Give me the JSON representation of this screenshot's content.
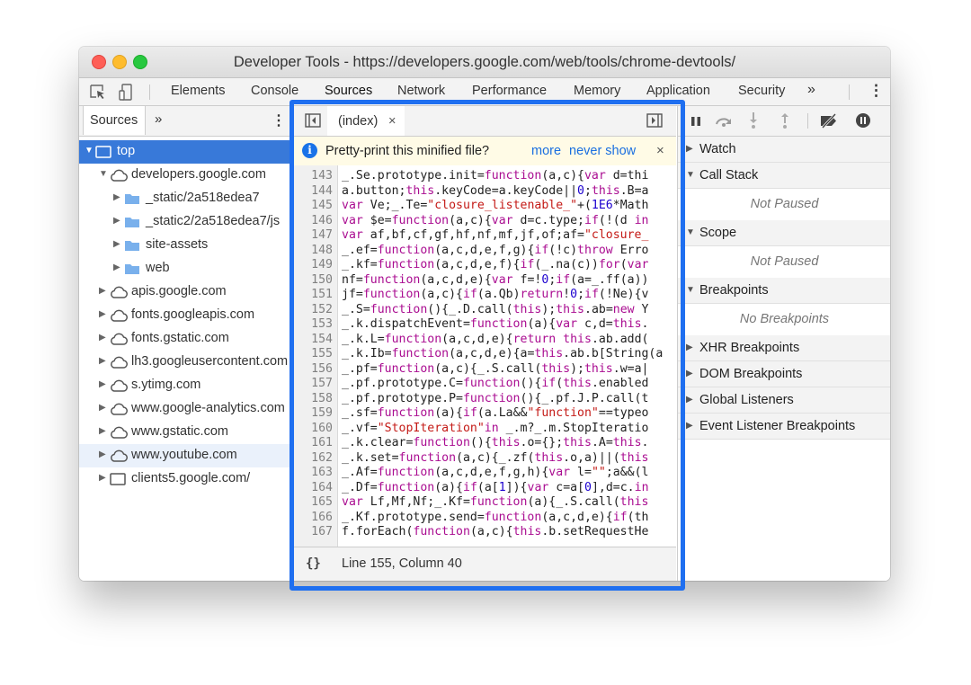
{
  "window": {
    "title": "Developer Tools - https://developers.google.com/web/tools/chrome-devtools/"
  },
  "panel_tabs": {
    "items": [
      "Elements",
      "Console",
      "Sources",
      "Network",
      "Performance",
      "Memory",
      "Application",
      "Security"
    ],
    "active": "Sources",
    "more": "»",
    "menu": "⋮"
  },
  "navigator": {
    "tab_label": "Sources",
    "more": "»",
    "menu": "⋮",
    "tree": [
      {
        "label": "top",
        "level": 0,
        "expanded": true,
        "icon": "frame-icon",
        "selected": true
      },
      {
        "label": "developers.google.com",
        "level": 1,
        "expanded": true,
        "icon": "cloud-icon"
      },
      {
        "label": "_static/2a518edea7",
        "level": 2,
        "expanded": false,
        "icon": "folder-icon"
      },
      {
        "label": "_static2/2a518edea7/js",
        "level": 2,
        "expanded": false,
        "icon": "folder-icon"
      },
      {
        "label": "site-assets",
        "level": 2,
        "expanded": false,
        "icon": "folder-icon"
      },
      {
        "label": "web",
        "level": 2,
        "expanded": false,
        "icon": "folder-icon"
      },
      {
        "label": "apis.google.com",
        "level": 1,
        "expanded": false,
        "icon": "cloud-icon"
      },
      {
        "label": "fonts.googleapis.com",
        "level": 1,
        "expanded": false,
        "icon": "cloud-icon"
      },
      {
        "label": "fonts.gstatic.com",
        "level": 1,
        "expanded": false,
        "icon": "cloud-icon"
      },
      {
        "label": "lh3.googleusercontent.com",
        "level": 1,
        "expanded": false,
        "icon": "cloud-icon"
      },
      {
        "label": "s.ytimg.com",
        "level": 1,
        "expanded": false,
        "icon": "cloud-icon"
      },
      {
        "label": "www.google-analytics.com",
        "level": 1,
        "expanded": false,
        "icon": "cloud-icon"
      },
      {
        "label": "www.gstatic.com",
        "level": 1,
        "expanded": false,
        "icon": "cloud-icon"
      },
      {
        "label": "www.youtube.com",
        "level": 1,
        "expanded": false,
        "icon": "cloud-icon",
        "hover": true
      },
      {
        "label": "clients5.google.com/",
        "level": 1,
        "expanded": false,
        "icon": "frame-icon"
      }
    ]
  },
  "editor": {
    "tab_label": "(index)",
    "tab_close": "×",
    "infobar": {
      "message": "Pretty-print this minified file?",
      "more_link": "more",
      "never_link": "never show",
      "close": "×"
    },
    "lines": [
      {
        "n": "143",
        "text": "_.Se.prototype.init=function(a,c){var d=thi"
      },
      {
        "n": "144",
        "text": "a.button;this.keyCode=a.keyCode||0;this.B=a"
      },
      {
        "n": "145",
        "text": "var Ve;_.Te=\"closure_listenable_\"+(1E6*Math"
      },
      {
        "n": "146",
        "text": "var $e=function(a,c){var d=c.type;if(!(d in"
      },
      {
        "n": "147",
        "text": "var af,bf,cf,gf,hf,nf,mf,jf,of;af=\"closure_"
      },
      {
        "n": "148",
        "text": "_.ef=function(a,c,d,e,f,g){if(!c)throw Erro"
      },
      {
        "n": "149",
        "text": "_.kf=function(a,c,d,e,f){if(_.na(c))for(var"
      },
      {
        "n": "150",
        "text": "nf=function(a,c,d,e){var f=!0;if(a=_.ff(a))"
      },
      {
        "n": "151",
        "text": "jf=function(a,c){if(a.Qb)return!0;if(!Ne){v"
      },
      {
        "n": "152",
        "text": "_.S=function(){_.D.call(this);this.ab=new Y"
      },
      {
        "n": "153",
        "text": "_.k.dispatchEvent=function(a){var c,d=this."
      },
      {
        "n": "154",
        "text": "_.k.L=function(a,c,d,e){return this.ab.add("
      },
      {
        "n": "155",
        "text": "_.k.Ib=function(a,c,d,e){a=this.ab.b[String(a"
      },
      {
        "n": "156",
        "text": "_.pf=function(a,c){_.S.call(this);this.w=a|"
      },
      {
        "n": "157",
        "text": "_.pf.prototype.C=function(){if(this.enabled"
      },
      {
        "n": "158",
        "text": "_.pf.prototype.P=function(){_.pf.J.P.call(t"
      },
      {
        "n": "159",
        "text": "_.sf=function(a){if(a.La&&\"function\"==typeo"
      },
      {
        "n": "160",
        "text": "_.vf=\"StopIteration\"in _.m?_.m.StopIteratio"
      },
      {
        "n": "161",
        "text": "_.k.clear=function(){this.o={};this.A=this."
      },
      {
        "n": "162",
        "text": "_.k.set=function(a,c){_.zf(this.o,a)||(this"
      },
      {
        "n": "163",
        "text": "_.Af=function(a,c,d,e,f,g,h){var l=\"\";a&&(l"
      },
      {
        "n": "164",
        "text": "_.Df=function(a){if(a[1]){var c=a[0],d=c.in"
      },
      {
        "n": "165",
        "text": "var Lf,Mf,Nf;_.Kf=function(a){_.S.call(this"
      },
      {
        "n": "166",
        "text": "_.Kf.prototype.send=function(a,c,d,e){if(th"
      },
      {
        "n": "167",
        "text": "f.forEach(function(a,c){this.b.setRequestHe"
      }
    ],
    "status": {
      "format_icon": "{}",
      "position": "Line 155, Column 40"
    },
    "highlight_color": "#1f6ff0"
  },
  "debugger": {
    "sections": [
      {
        "label": "Watch",
        "expanded": false
      },
      {
        "label": "Call Stack",
        "expanded": true,
        "body": "Not Paused"
      },
      {
        "label": "Scope",
        "expanded": true,
        "body": "Not Paused"
      },
      {
        "label": "Breakpoints",
        "expanded": true,
        "body": "No Breakpoints"
      },
      {
        "label": "XHR Breakpoints",
        "expanded": false
      },
      {
        "label": "DOM Breakpoints",
        "expanded": false
      },
      {
        "label": "Global Listeners",
        "expanded": false
      },
      {
        "label": "Event Listener Breakpoints",
        "expanded": false
      }
    ]
  }
}
